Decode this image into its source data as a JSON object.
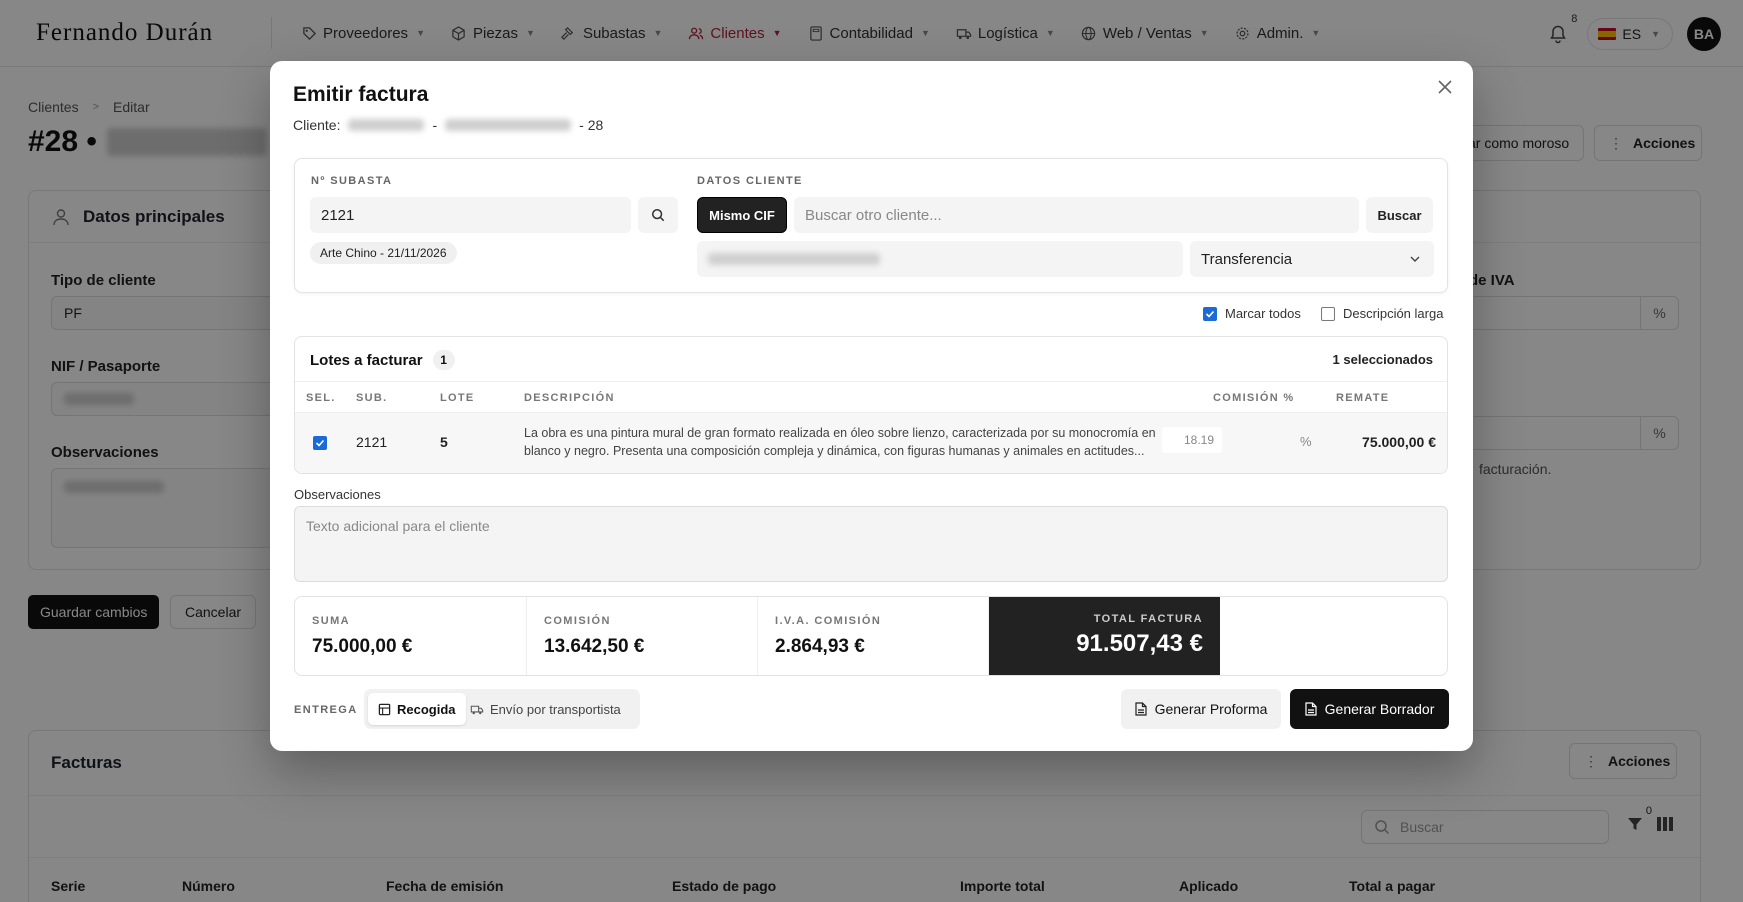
{
  "nav": {
    "logo": "Fernando Durán",
    "items": [
      {
        "label": "Proveedores",
        "icon": "tag-icon",
        "active": false
      },
      {
        "label": "Piezas",
        "icon": "cube-icon",
        "active": false
      },
      {
        "label": "Subastas",
        "icon": "gavel-icon",
        "active": false
      },
      {
        "label": "Clientes",
        "icon": "users-icon",
        "active": true
      },
      {
        "label": "Contabilidad",
        "icon": "calculator-icon",
        "active": false
      },
      {
        "label": "Logística",
        "icon": "truck-icon",
        "active": false
      },
      {
        "label": "Web / Ventas",
        "icon": "globe-icon",
        "active": false
      },
      {
        "label": "Admin.",
        "icon": "gear-icon",
        "active": false
      }
    ],
    "notifications": "8",
    "language": "ES",
    "avatar": "BA"
  },
  "page": {
    "breadcrumb": [
      "Clientes",
      "Editar"
    ],
    "title_id": "#28 •",
    "action_partial": "car como moroso",
    "actions_label": "Acciones",
    "main_card": {
      "title": "Datos principales",
      "tipo_label": "Tipo de cliente",
      "tipo_value": "PF",
      "nif_label": "NIF / Pasaporte",
      "obs_label": "Observaciones",
      "iva_label": "de IVA",
      "pct": "%",
      "footnote": "facturación."
    },
    "save_label": "Guardar cambios",
    "cancel_label": "Cancelar",
    "invoices": {
      "title": "Facturas",
      "actions_label": "Acciones",
      "search_placeholder": "Buscar",
      "filter_count": "0",
      "columns": [
        "Serie",
        "Número",
        "Fecha de emisión",
        "Estado de pago",
        "Importe total",
        "Aplicado",
        "Total a pagar"
      ]
    }
  },
  "modal": {
    "title": "Emitir factura",
    "client_prefix": "Cliente:",
    "client_dash": "-",
    "client_suffix": "- 28",
    "subasta_label": "Nº SUBASTA",
    "subasta_value": "2121",
    "subasta_chip": "Arte Chino - 21/11/2026",
    "cliente_label": "DATOS CLIENTE",
    "same_cif": "Mismo CIF",
    "search_placeholder": "Buscar otro cliente...",
    "search_btn": "Buscar",
    "payment_method": "Transferencia",
    "mark_all": "Marcar todos",
    "long_desc": "Descripción larga",
    "lots": {
      "title": "Lotes a facturar",
      "count": "1",
      "selected": "1 seleccionados",
      "columns": {
        "sel": "SEL.",
        "sub": "SUB.",
        "lote": "LOTE",
        "desc": "DESCRIPCIÓN",
        "comision": "COMISIÓN %",
        "remate": "REMATE"
      },
      "rows": [
        {
          "sub": "2121",
          "lote": "5",
          "description": "La obra es una pintura mural de gran formato realizada en óleo sobre lienzo, caracterizada por su monocromía en blanco y negro. Presenta una composición compleja y dinámica, con figuras humanas y animales en actitudes...",
          "commission": "18.19",
          "pct": "%",
          "remate": "75.000,00 €",
          "checked": true
        }
      ]
    },
    "obs_label": "Observaciones",
    "obs_placeholder": "Texto adicional para el cliente",
    "totals": {
      "suma_label": "SUMA",
      "suma": "75.000,00 €",
      "comision_label": "COMISIÓN",
      "comision": "13.642,50 €",
      "iva_label": "I.V.A. COMISIÓN",
      "iva": "2.864,93 €",
      "total_label": "TOTAL FACTURA",
      "total": "91.507,43 €"
    },
    "entrega_label": "ENTREGA",
    "entrega_options": [
      "Recogida",
      "Envío por transportista"
    ],
    "proforma_btn": "Generar Proforma",
    "borrador_btn": "Generar Borrador"
  },
  "colors": {
    "accent": "#b3243a",
    "dark": "#222222",
    "checkbox": "#1a6ad8"
  }
}
